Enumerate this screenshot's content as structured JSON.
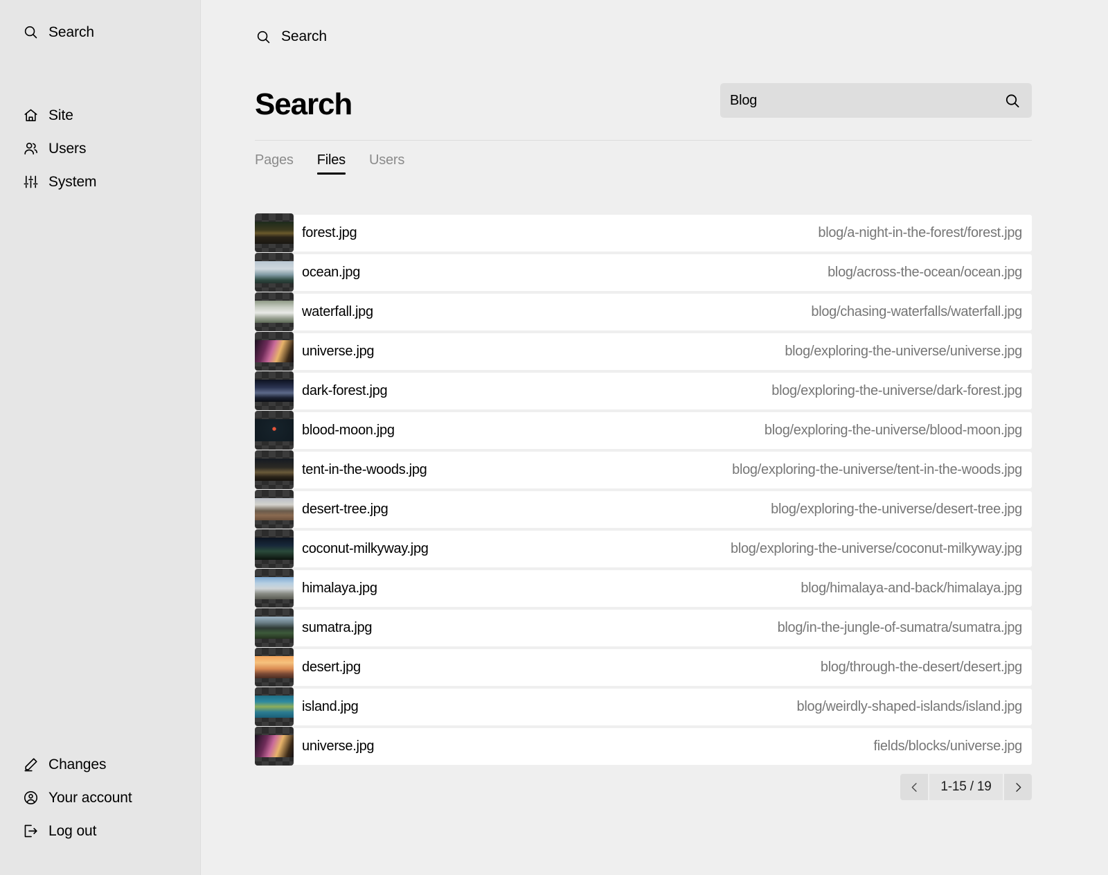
{
  "sidebar": {
    "search": {
      "label": "Search",
      "icon": "search-icon"
    },
    "items": [
      {
        "label": "Site",
        "icon": "home-icon"
      },
      {
        "label": "Users",
        "icon": "users-icon"
      },
      {
        "label": "System",
        "icon": "sliders-icon"
      }
    ],
    "footer_items": [
      {
        "label": "Changes",
        "icon": "pencil-icon"
      },
      {
        "label": "Your account",
        "icon": "user-circle-icon"
      },
      {
        "label": "Log out",
        "icon": "logout-icon"
      }
    ]
  },
  "topbar": {
    "label": "Search",
    "icon": "search-icon"
  },
  "header": {
    "title": "Search",
    "search": {
      "value": "Blog",
      "placeholder": "Search",
      "icon": "search-icon"
    }
  },
  "tabs": [
    {
      "label": "Pages",
      "active": false
    },
    {
      "label": "Files",
      "active": true
    },
    {
      "label": "Users",
      "active": false
    }
  ],
  "files": [
    {
      "name": "forest.jpg",
      "path": "blog/a-night-in-the-forest/forest.jpg",
      "thumb": "forest"
    },
    {
      "name": "ocean.jpg",
      "path": "blog/across-the-ocean/ocean.jpg",
      "thumb": "ocean"
    },
    {
      "name": "waterfall.jpg",
      "path": "blog/chasing-waterfalls/waterfall.jpg",
      "thumb": "waterfall"
    },
    {
      "name": "universe.jpg",
      "path": "blog/exploring-the-universe/universe.jpg",
      "thumb": "universe"
    },
    {
      "name": "dark-forest.jpg",
      "path": "blog/exploring-the-universe/dark-forest.jpg",
      "thumb": "darkforest"
    },
    {
      "name": "blood-moon.jpg",
      "path": "blog/exploring-the-universe/blood-moon.jpg",
      "thumb": "bloodmoon"
    },
    {
      "name": "tent-in-the-woods.jpg",
      "path": "blog/exploring-the-universe/tent-in-the-woods.jpg",
      "thumb": "tent"
    },
    {
      "name": "desert-tree.jpg",
      "path": "blog/exploring-the-universe/desert-tree.jpg",
      "thumb": "deserttree"
    },
    {
      "name": "coconut-milkyway.jpg",
      "path": "blog/exploring-the-universe/coconut-milkyway.jpg",
      "thumb": "coconut"
    },
    {
      "name": "himalaya.jpg",
      "path": "blog/himalaya-and-back/himalaya.jpg",
      "thumb": "himalaya"
    },
    {
      "name": "sumatra.jpg",
      "path": "blog/in-the-jungle-of-sumatra/sumatra.jpg",
      "thumb": "sumatra"
    },
    {
      "name": "desert.jpg",
      "path": "blog/through-the-desert/desert.jpg",
      "thumb": "desert"
    },
    {
      "name": "island.jpg",
      "path": "blog/weirdly-shaped-islands/island.jpg",
      "thumb": "island"
    },
    {
      "name": "universe.jpg",
      "path": "fields/blocks/universe.jpg",
      "thumb": "universe"
    }
  ],
  "pagination": {
    "range": "1-15 / 19",
    "prev_icon": "chevron-left-icon",
    "next_icon": "chevron-right-icon"
  },
  "colors": {
    "sidebar_bg": "#e6e6e6",
    "main_bg": "#efefef",
    "row_bg": "#ffffff",
    "input_bg": "#dedede",
    "muted_text": "#767676",
    "tab_inactive": "#8b8b8b"
  }
}
